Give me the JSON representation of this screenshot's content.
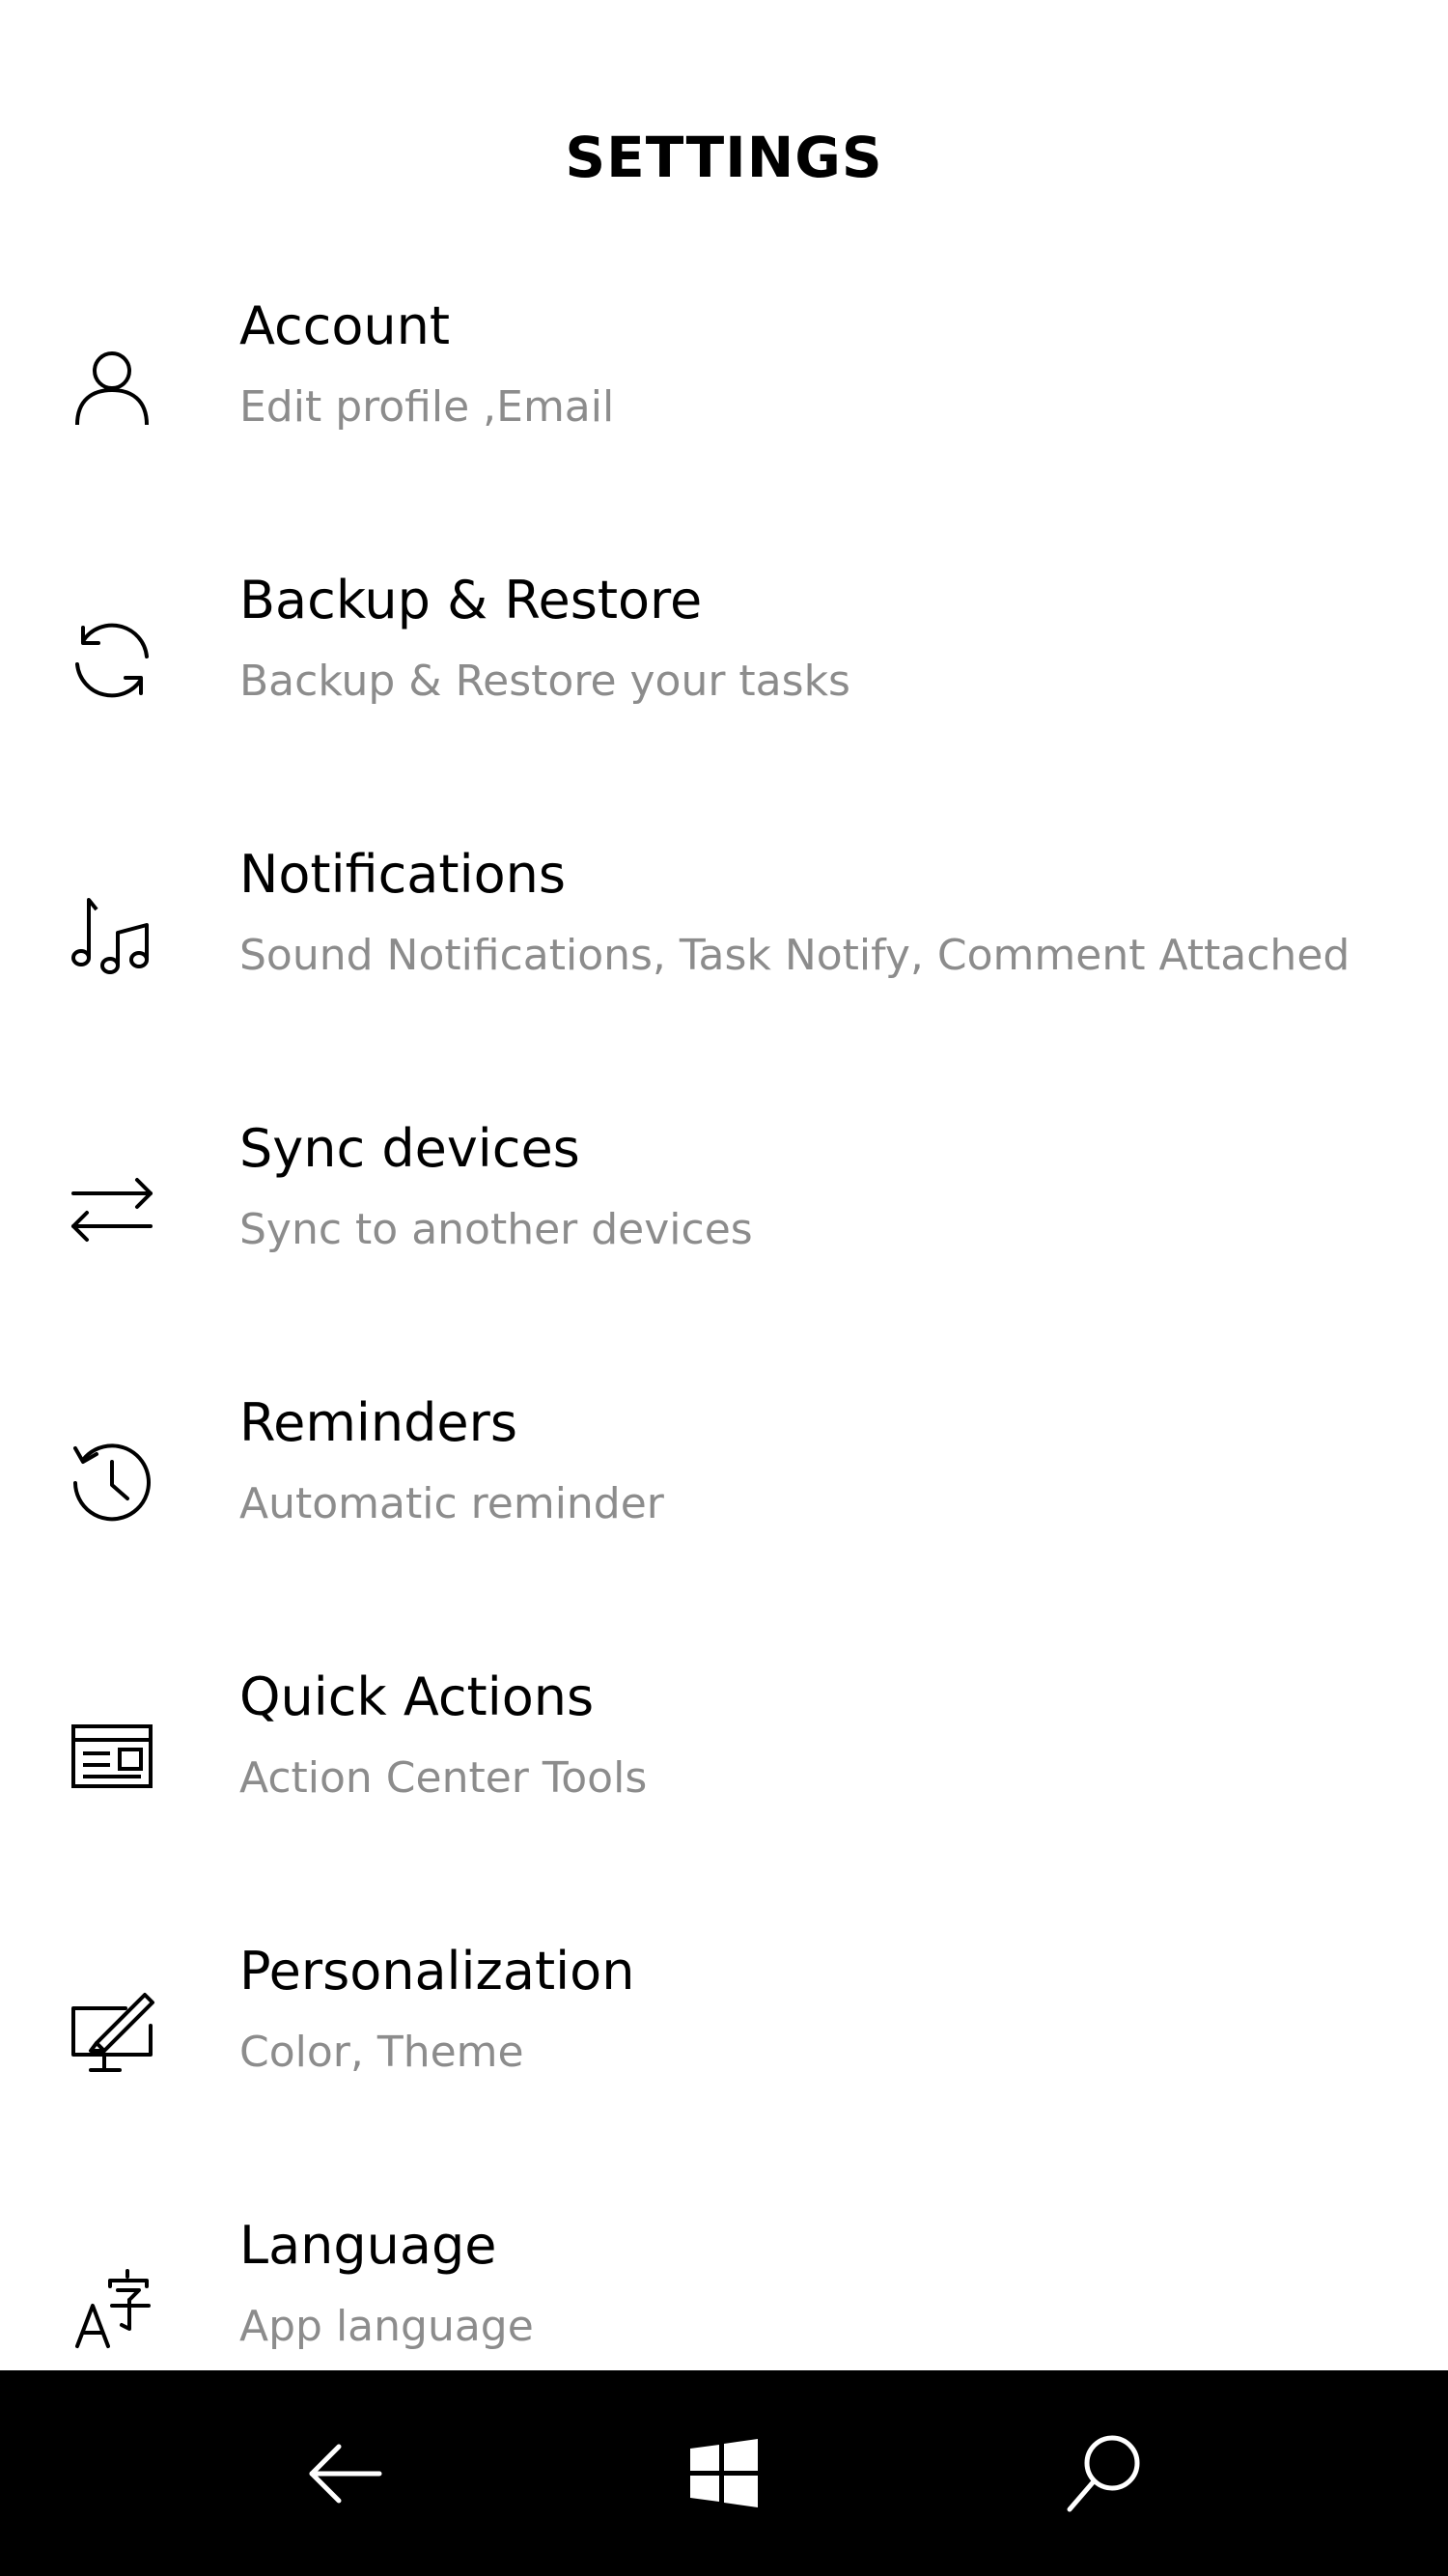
{
  "header": {
    "title": "SETTINGS"
  },
  "settings": {
    "items": [
      {
        "icon": "person-icon",
        "title": "Account",
        "subtitle": "Edit profile ,Email"
      },
      {
        "icon": "sync-arrows-icon",
        "title": "Backup & Restore",
        "subtitle": "Backup & Restore your tasks"
      },
      {
        "icon": "music-notes-icon",
        "title": "Notifications",
        "subtitle": "Sound Notifications, Task Notify, Comment Attached"
      },
      {
        "icon": "swap-arrows-icon",
        "title": "Sync devices",
        "subtitle": "Sync to another devices"
      },
      {
        "icon": "history-clock-icon",
        "title": "Reminders",
        "subtitle": "Automatic reminder"
      },
      {
        "icon": "action-center-icon",
        "title": "Quick Actions",
        "subtitle": "Action Center Tools"
      },
      {
        "icon": "personalization-icon",
        "title": "Personalization",
        "subtitle": "Color, Theme"
      },
      {
        "icon": "language-icon",
        "title": "Language",
        "subtitle": "App language"
      }
    ]
  },
  "taskbar": {
    "buttons": [
      "back-arrow-icon",
      "windows-logo-icon",
      "search-icon"
    ],
    "background": "#000000",
    "icon_color": "#ffffff"
  },
  "colors": {
    "background": "#ffffff",
    "title_text": "#000000",
    "subtitle_text": "#8c8c8c"
  }
}
